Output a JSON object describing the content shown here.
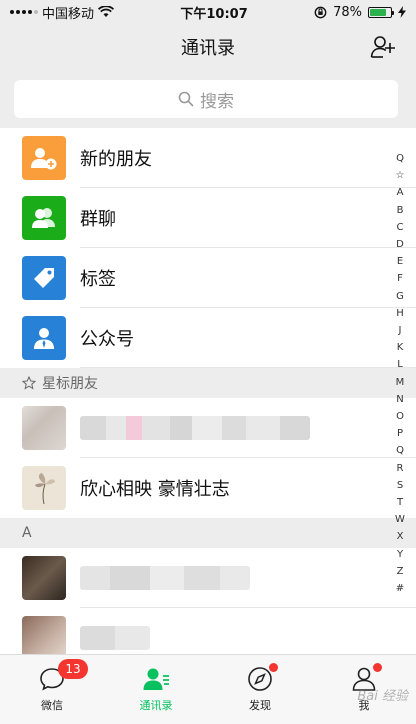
{
  "status_bar": {
    "carrier": "中国移动",
    "time": "下午10:07",
    "battery_percent": "78%",
    "battery_level": 0.78
  },
  "nav": {
    "title": "通讯录",
    "add_icon": "add-contact-icon"
  },
  "search": {
    "placeholder": "搜索"
  },
  "functions": [
    {
      "label": "新的朋友",
      "icon": "new-friends-icon",
      "color": "#fa9d3b"
    },
    {
      "label": "群聊",
      "icon": "group-chat-icon",
      "color": "#1aad19"
    },
    {
      "label": "标签",
      "icon": "tag-icon",
      "color": "#2782d7"
    },
    {
      "label": "公众号",
      "icon": "official-account-icon",
      "color": "#2782d7"
    }
  ],
  "starred": {
    "header": "星标朋友",
    "contacts": [
      {
        "name": "",
        "blurred": true
      },
      {
        "name": "欣心相映 豪情壮志",
        "blurred": false
      }
    ]
  },
  "section_a": {
    "header": "A"
  },
  "index_letters": [
    "Q",
    "☆",
    "A",
    "B",
    "C",
    "D",
    "E",
    "F",
    "G",
    "H",
    "J",
    "K",
    "L",
    "M",
    "N",
    "O",
    "P",
    "Q",
    "R",
    "S",
    "T",
    "W",
    "X",
    "Y",
    "Z",
    "#"
  ],
  "tabs": [
    {
      "label": "微信",
      "icon": "chat-bubble-icon",
      "badge": "13"
    },
    {
      "label": "通讯录",
      "icon": "contacts-icon",
      "active": true
    },
    {
      "label": "发现",
      "icon": "compass-icon",
      "dot": true
    },
    {
      "label": "我",
      "icon": "profile-icon",
      "dot": true
    }
  ],
  "colors": {
    "accent": "#07c160",
    "badge": "#f43530"
  }
}
